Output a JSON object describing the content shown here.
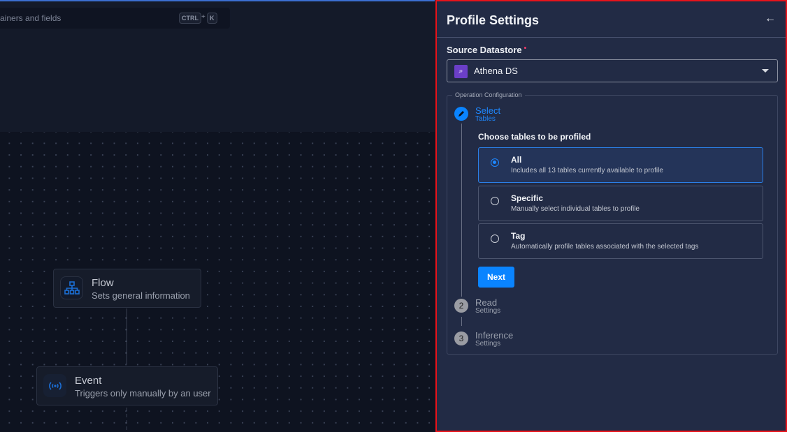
{
  "search": {
    "placeholder_visible": "ainers and fields",
    "shortcut_key1": "CTRL",
    "shortcut_plus": "+",
    "shortcut_key2": "K"
  },
  "flow_nodes": [
    {
      "title": "Flow",
      "subtitle": "Sets general information",
      "icon": "sitemap-icon"
    },
    {
      "title": "Event",
      "subtitle": "Triggers only manually by an user",
      "icon": "broadcast-icon"
    }
  ],
  "panel": {
    "title": "Profile Settings",
    "back_icon": "←",
    "source_label": "Source Datastore",
    "required_mark": "•",
    "datastore": {
      "value": "Athena DS",
      "icon": "athena-icon"
    },
    "operation_config": {
      "legend": "Operation Configuration",
      "steps": [
        {
          "title": "Select",
          "subtitle": "Tables",
          "state": "active"
        },
        {
          "number": "2",
          "title": "Read",
          "subtitle": "Settings",
          "state": "pending"
        },
        {
          "number": "3",
          "title": "Inference",
          "subtitle": "Settings",
          "state": "pending"
        }
      ],
      "choose_label": "Choose tables to be profiled",
      "options": [
        {
          "title": "All",
          "description": "Includes all 13 tables currently available to profile",
          "selected": true
        },
        {
          "title": "Specific",
          "description": "Manually select individual tables to profile",
          "selected": false
        },
        {
          "title": "Tag",
          "description": "Automatically profile tables associated with the selected tags",
          "selected": false
        }
      ],
      "next_label": "Next"
    }
  },
  "colors": {
    "accent": "#0a84ff",
    "panel_bg": "#222b45",
    "canvas_bg": "#0e1320",
    "highlight_border": "#e8131b",
    "required": "#ff3d6e"
  }
}
